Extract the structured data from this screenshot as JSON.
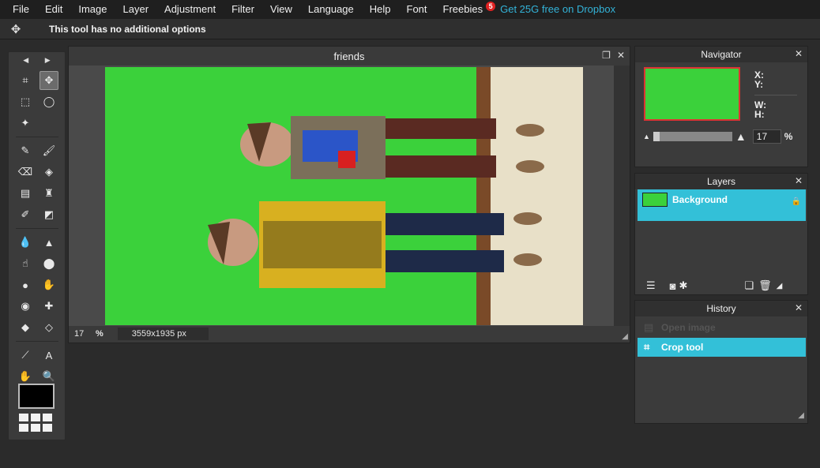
{
  "menubar": {
    "items": [
      "File",
      "Edit",
      "Image",
      "Layer",
      "Adjustment",
      "Filter",
      "View",
      "Language",
      "Help",
      "Font",
      "Freebies"
    ],
    "freebies_badge": "5",
    "promo": "Get 25G free on Dropbox"
  },
  "options_bar": {
    "tool_icon": "move-icon",
    "message": "This tool has no additional options"
  },
  "toolbox": {
    "tools": [
      {
        "name": "crop-icon",
        "glyph": "⌗"
      },
      {
        "name": "move-icon",
        "glyph": "✥"
      },
      {
        "name": "marquee-icon",
        "glyph": "⬚"
      },
      {
        "name": "lasso-icon",
        "glyph": "◯"
      },
      {
        "name": "magic-wand-icon",
        "glyph": "✦"
      },
      {
        "name": "pencil-icon",
        "glyph": "✎"
      },
      {
        "name": "brush-icon",
        "glyph": "🖌"
      },
      {
        "name": "eraser-icon",
        "glyph": "⌫"
      },
      {
        "name": "bucket-icon",
        "glyph": "◈"
      },
      {
        "name": "gradient-icon",
        "glyph": "▤"
      },
      {
        "name": "stamp-icon",
        "glyph": "♜"
      },
      {
        "name": "color-replace-icon",
        "glyph": "✐"
      },
      {
        "name": "drawing-icon",
        "glyph": "◩"
      },
      {
        "name": "blur-icon",
        "glyph": "💧"
      },
      {
        "name": "sharpen-icon",
        "glyph": "▲"
      },
      {
        "name": "smudge-icon",
        "glyph": "☝"
      },
      {
        "name": "sponge-icon",
        "glyph": "⬤"
      },
      {
        "name": "dodge-icon",
        "glyph": "●"
      },
      {
        "name": "burn-icon",
        "glyph": "✋"
      },
      {
        "name": "red-eye-icon",
        "glyph": "◉"
      },
      {
        "name": "spot-heal-icon",
        "glyph": "✚"
      },
      {
        "name": "bloat-icon",
        "glyph": "◆"
      },
      {
        "name": "pinch-icon",
        "glyph": "◇"
      },
      {
        "name": "color-picker-icon",
        "glyph": "⟋"
      },
      {
        "name": "type-icon",
        "glyph": "A"
      },
      {
        "name": "hand-icon",
        "glyph": "✋"
      },
      {
        "name": "zoom-icon",
        "glyph": "🔍"
      }
    ]
  },
  "document": {
    "title": "friends",
    "zoom": "17",
    "zoom_unit": "%",
    "dimensions": "3559x1935 px"
  },
  "navigator": {
    "title": "Navigator",
    "x_label": "X:",
    "y_label": "Y:",
    "w_label": "W:",
    "h_label": "H:",
    "zoom_value": "17",
    "zoom_unit": "%"
  },
  "layers": {
    "title": "Layers",
    "items": [
      {
        "name": "Background",
        "locked": true
      }
    ]
  },
  "history": {
    "title": "History",
    "items": [
      {
        "label": "Open image",
        "state": "dim"
      },
      {
        "label": "Crop tool",
        "state": "active"
      }
    ]
  },
  "colors": {
    "accent": "#33c0d8",
    "green_screen": "#3bd13b",
    "badge": "#e02222"
  }
}
